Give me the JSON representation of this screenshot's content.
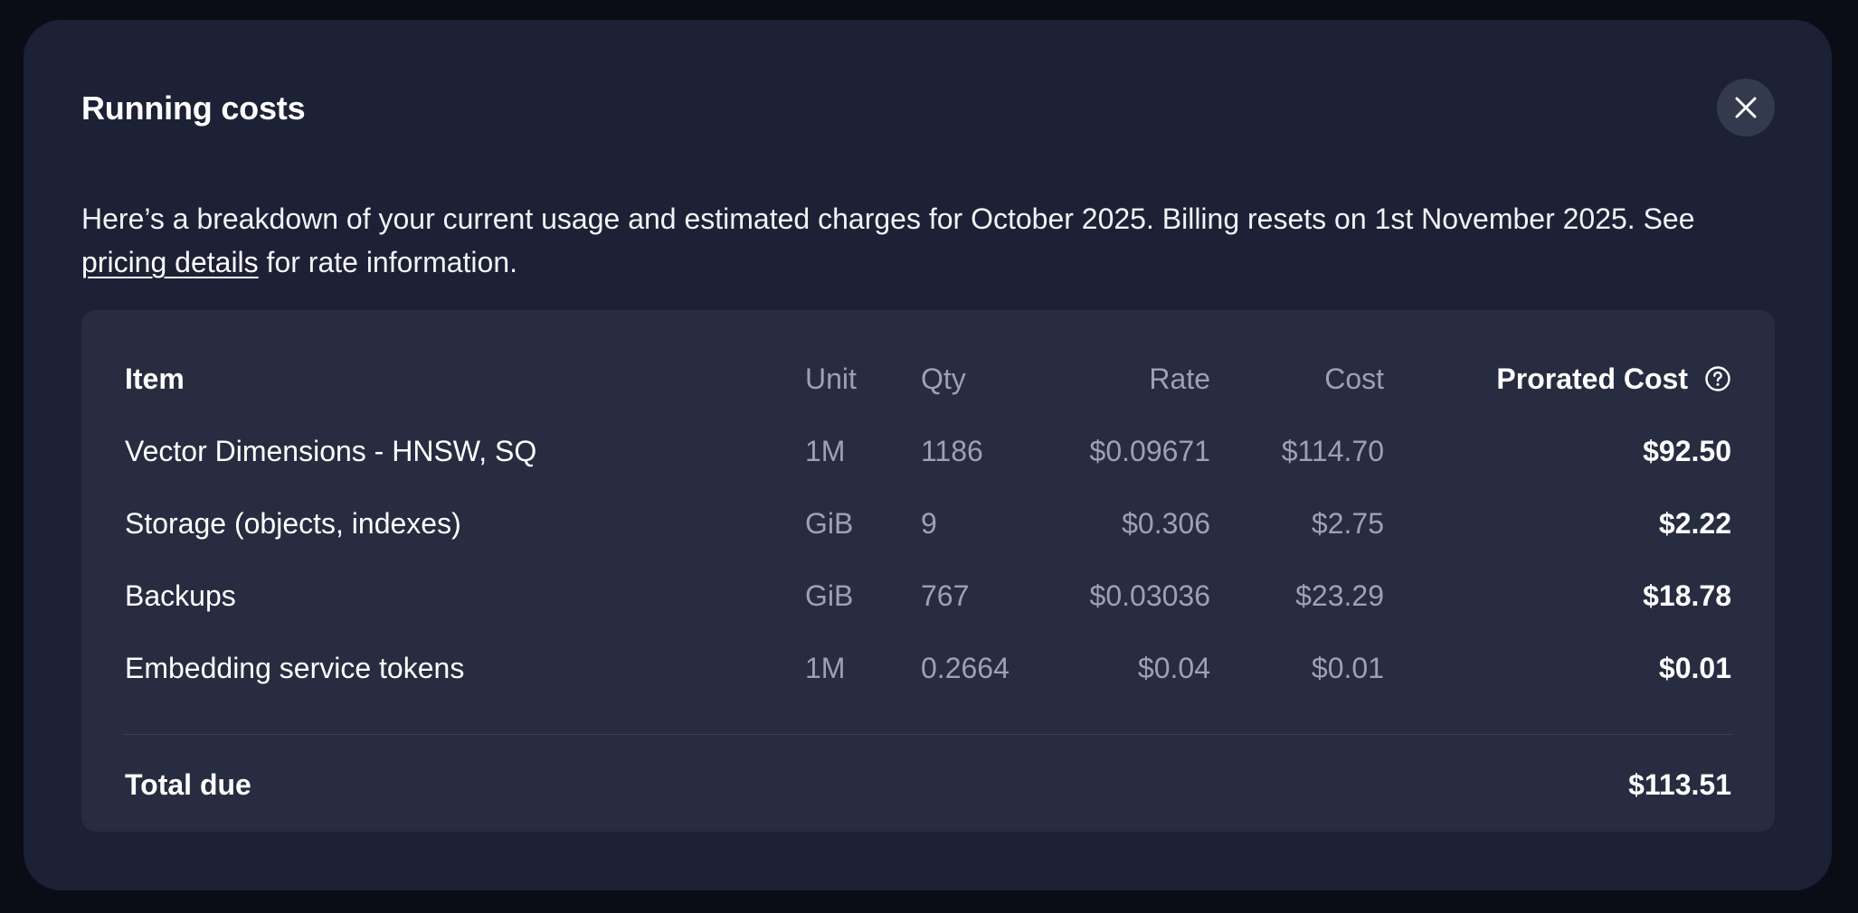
{
  "modal": {
    "title": "Running costs",
    "description_prefix": "Here’s a breakdown of your current usage and estimated charges for October 2025. Billing resets on 1st November 2025. See ",
    "description_link": "pricing details",
    "description_suffix": " for rate information."
  },
  "table": {
    "headers": {
      "item": "Item",
      "unit": "Unit",
      "qty": "Qty",
      "rate": "Rate",
      "cost": "Cost",
      "prorated_cost": "Prorated Cost"
    },
    "rows": [
      {
        "item": "Vector Dimensions - HNSW, SQ",
        "unit": "1M",
        "qty": "1186",
        "rate": "$0.09671",
        "cost": "$114.70",
        "prorated_cost": "$92.50"
      },
      {
        "item": "Storage (objects, indexes)",
        "unit": "GiB",
        "qty": "9",
        "rate": "$0.306",
        "cost": "$2.75",
        "prorated_cost": "$2.22"
      },
      {
        "item": "Backups",
        "unit": "GiB",
        "qty": "767",
        "rate": "$0.03036",
        "cost": "$23.29",
        "prorated_cost": "$18.78"
      },
      {
        "item": "Embedding service tokens",
        "unit": "1M",
        "qty": "0.2664",
        "rate": "$0.04",
        "cost": "$0.01",
        "prorated_cost": "$0.01"
      }
    ],
    "total": {
      "label": "Total due",
      "value": "$113.51"
    }
  },
  "icons": {
    "close": "close-icon",
    "help": "help-circle-icon"
  },
  "colors": {
    "modal_bg": "#1c2135",
    "card_bg": "#272c40",
    "muted_text": "#9da2b1",
    "primary_text": "#ffffff"
  }
}
